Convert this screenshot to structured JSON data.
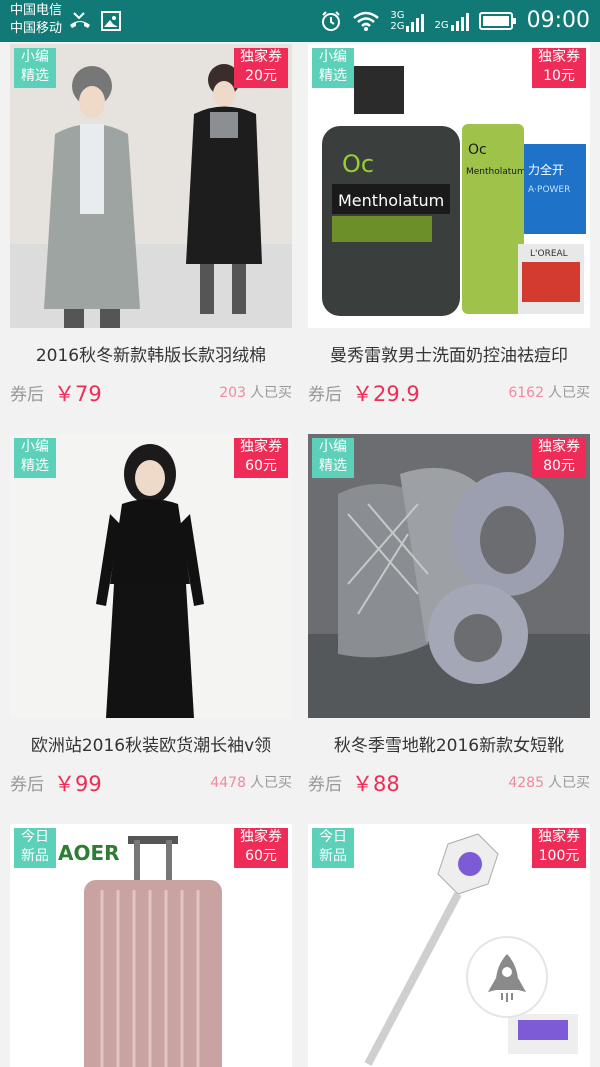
{
  "status_bar": {
    "carrier1": "中国电信",
    "carrier2": "中国移动",
    "net_3g": "3G",
    "net_2g_a": "2G",
    "net_2g_b": "2G",
    "time": "09:00"
  },
  "products": [
    {
      "tag_left_1": "小编",
      "tag_left_2": "精选",
      "coupon_1": "独家券",
      "coupon_2": "20元",
      "title": "2016秋冬新款韩版长款羽绒棉",
      "price_prefix": "券后",
      "price": "￥79",
      "buyers_count": "203",
      "buyers_label": "人已买"
    },
    {
      "tag_left_1": "小编",
      "tag_left_2": "精选",
      "coupon_1": "独家券",
      "coupon_2": "10元",
      "title": "曼秀雷敦男士洗面奶控油祛痘印",
      "price_prefix": "券后",
      "price": "￥29.9",
      "buyers_count": "6162",
      "buyers_label": "人已买",
      "img_texts": {
        "oc": "Oc",
        "brand": "Mentholatum",
        "brand_small": "Mentholatum",
        "side": "力全开",
        "side2": "A·POWER",
        "loreal": "L'OREAL"
      }
    },
    {
      "tag_left_1": "小编",
      "tag_left_2": "精选",
      "coupon_1": "独家券",
      "coupon_2": "60元",
      "title": "欧洲站2016秋装欧货潮长袖v领",
      "price_prefix": "券后",
      "price": "￥99",
      "buyers_count": "4478",
      "buyers_label": "人已买"
    },
    {
      "tag_left_1": "小编",
      "tag_left_2": "精选",
      "coupon_1": "独家券",
      "coupon_2": "80元",
      "title": "秋冬季雪地靴2016新款女短靴",
      "price_prefix": "券后",
      "price": "￥88",
      "buyers_count": "4285",
      "buyers_label": "人已买"
    },
    {
      "tag_left_1": "今日",
      "tag_left_2": "新品",
      "coupon_1": "独家券",
      "coupon_2": "60元",
      "brand_logo": "AOER",
      "title": "",
      "price_prefix": "",
      "price": "",
      "buyers_count": "",
      "buyers_label": ""
    },
    {
      "tag_left_1": "今日",
      "tag_left_2": "新品",
      "coupon_1": "独家券",
      "coupon_2": "100元",
      "title": "",
      "price_prefix": "",
      "price": "",
      "buyers_count": "",
      "buyers_label": ""
    }
  ],
  "icons": {
    "missed_call": "missed-call-icon",
    "gallery": "gallery-icon",
    "alarm": "alarm-icon",
    "wifi": "wifi-icon",
    "battery": "battery-icon",
    "rocket": "rocket-icon"
  },
  "colors": {
    "accent": "#ee2c57",
    "tag": "#5cd0b8",
    "statusbar": "#127a76"
  }
}
